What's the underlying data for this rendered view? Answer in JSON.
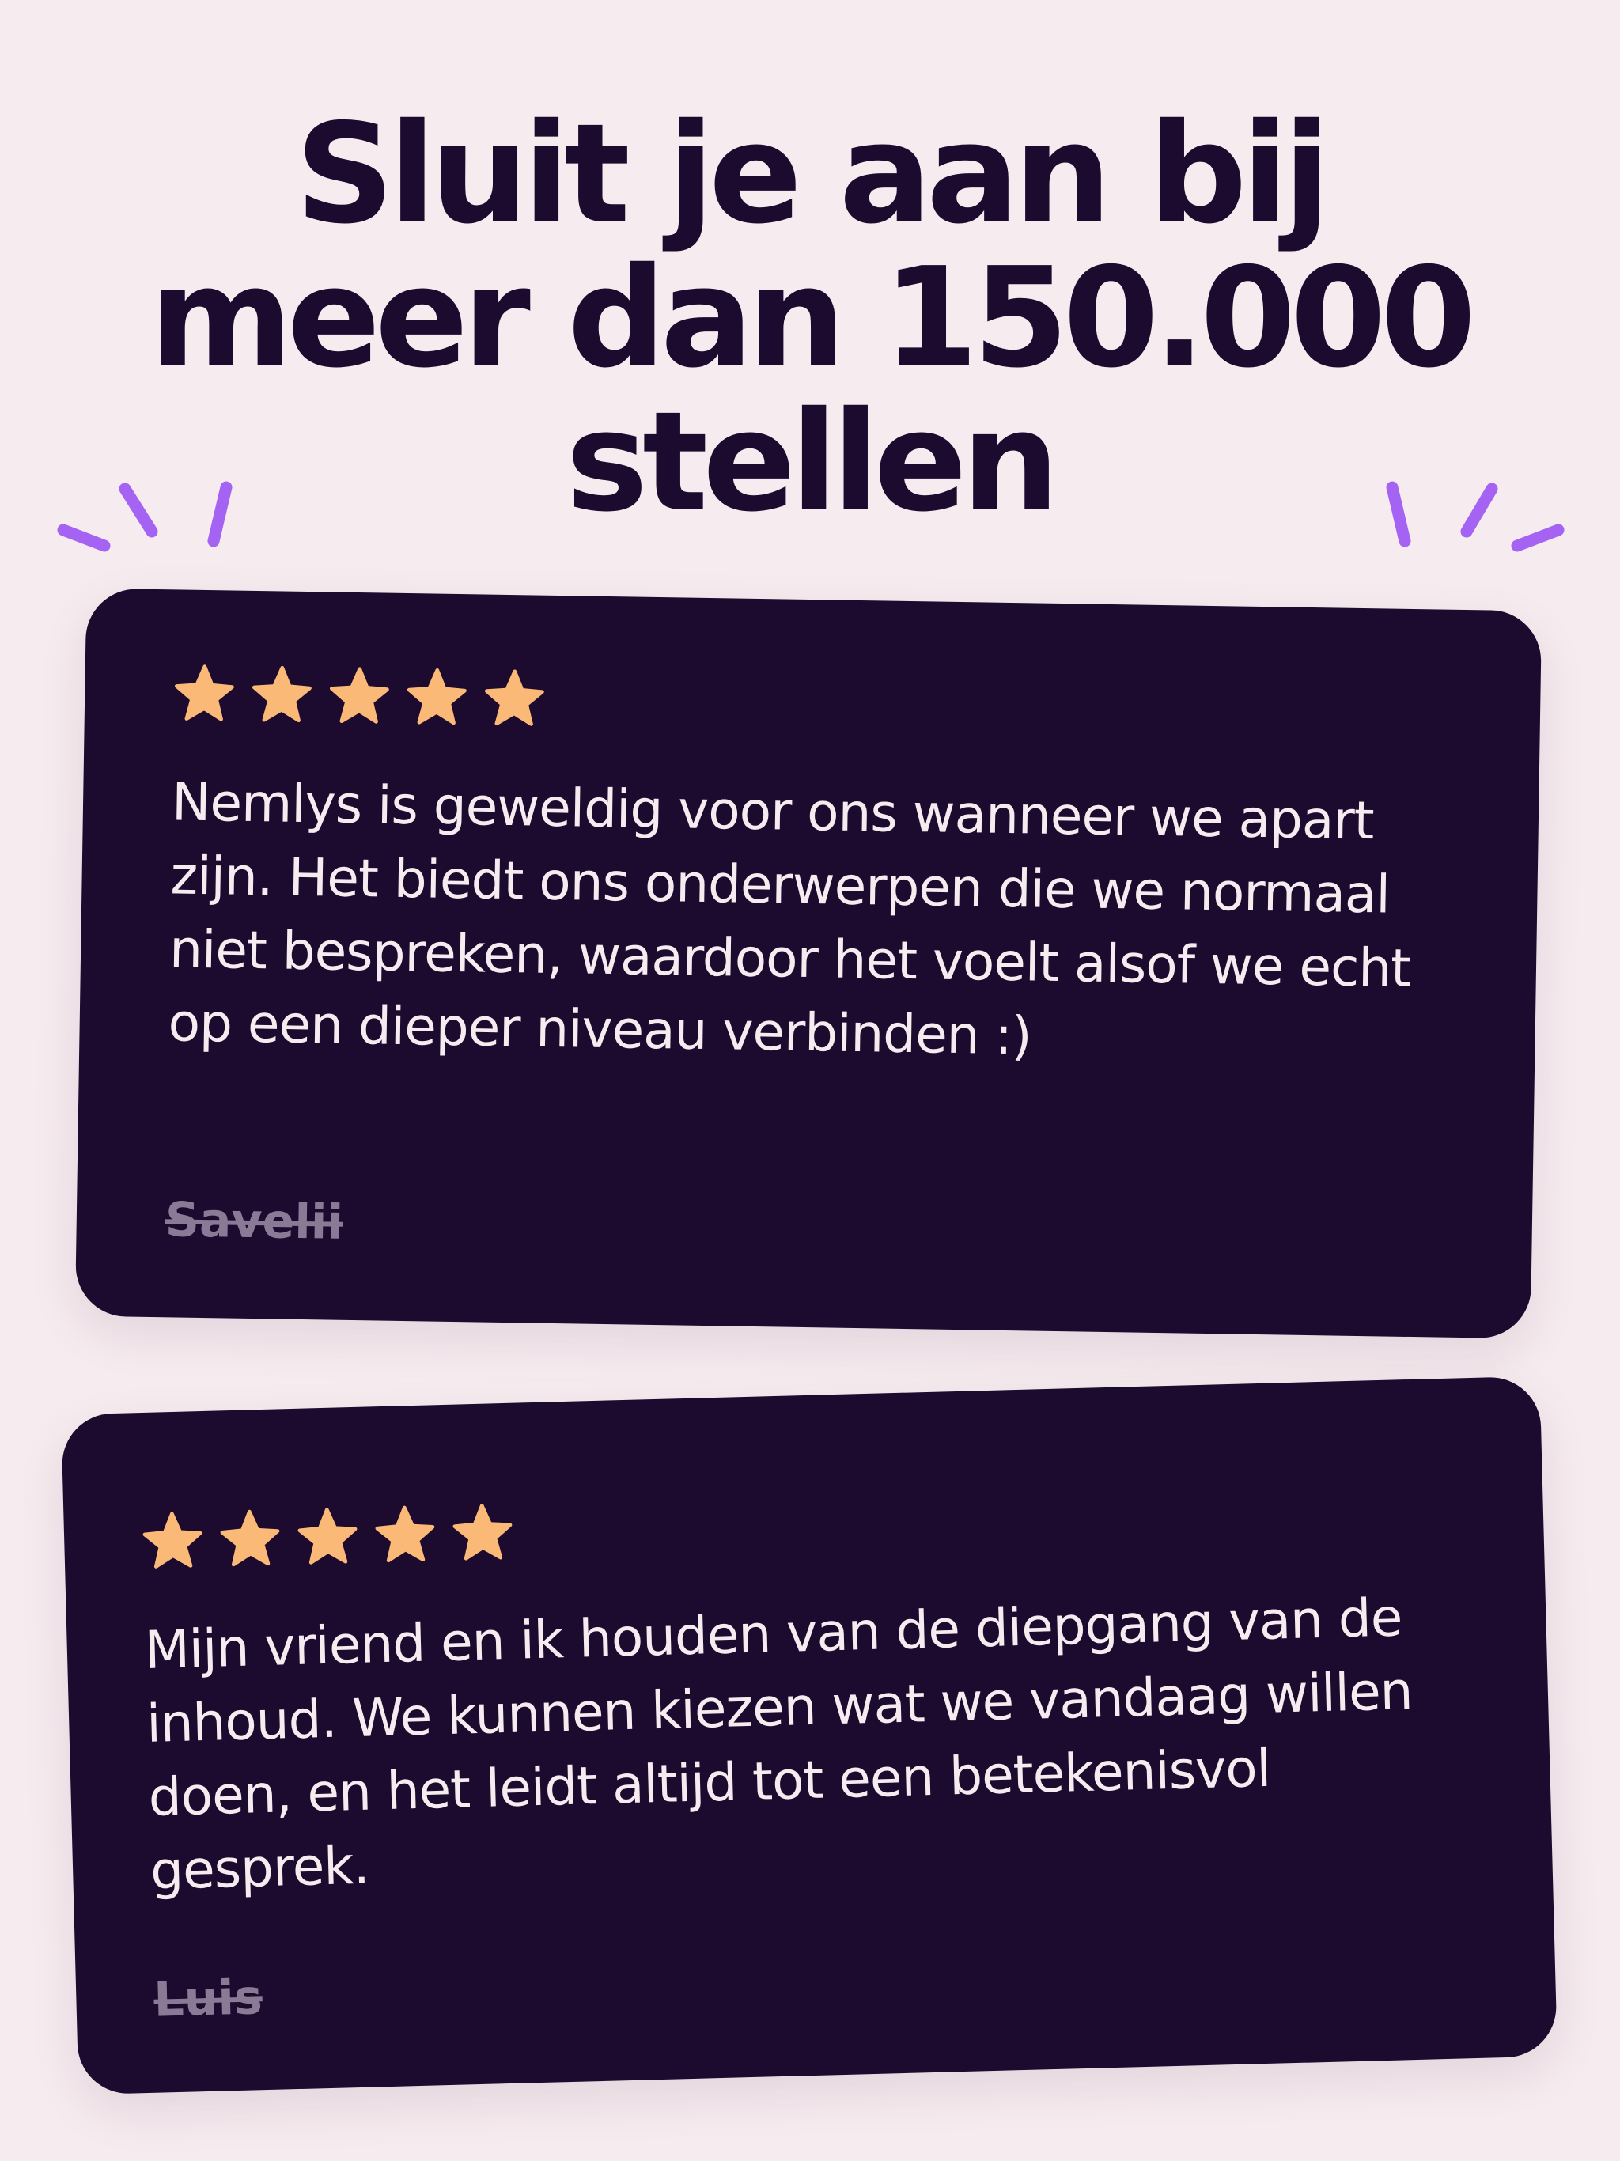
{
  "headline": {
    "line1": "Sluit je aan bij",
    "line2": "meer dan 150.000",
    "line3": "stellen"
  },
  "colors": {
    "background": "#f6ebef",
    "card": "#1c0a2f",
    "star": "#fbb977",
    "sparkle": "#a463f2",
    "review_text": "#f6ebef",
    "author_text": "#8a7a96"
  },
  "reviews": [
    {
      "rating": 5,
      "text": "Nemlys is geweldig voor ons wanneer we apart zijn. Het biedt ons onderwerpen die we normaal niet bespreken, waardoor het voelt alsof we echt op een dieper niveau verbinden :)",
      "author": "Savelii"
    },
    {
      "rating": 5,
      "text": "Mijn vriend en ik houden van de diepgang van de inhoud. We kunnen kiezen wat we vandaag willen doen, en het leidt altijd tot een betekenisvol gesprek.",
      "author": "Luis"
    }
  ],
  "icons": {
    "rating_star": "star-icon",
    "decoration": "sparkle-icon"
  }
}
